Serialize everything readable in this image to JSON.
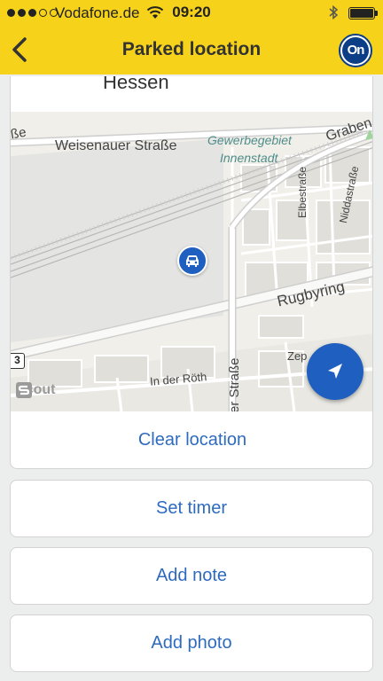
{
  "status_bar": {
    "signal_bars": 5,
    "signal_filled": 3,
    "carrier": "Vodafone.de",
    "time": "09:20",
    "battery_level": 1.0
  },
  "navbar": {
    "title": "Parked location",
    "back_icon": "chevron-left-icon",
    "logo_text": "On",
    "logo_colors": {
      "ring": "#0b3e86",
      "fill": "#0b3e86"
    }
  },
  "location": {
    "address_line": "Hessen"
  },
  "map": {
    "labels": {
      "weisenauer": "Weisenauer Straße",
      "graben": "Graben",
      "gewerbe_1": "Gewerbegebiet",
      "gewerbe_2": "Innenstadt",
      "strasse_left": "ße",
      "elbestrasse": "Elbestraße",
      "niddastrasse": "Niddastraße",
      "rugbyring": "Rugbyring",
      "in_der_roth": "In der Röth",
      "er_strasse": "er Straße",
      "zep": "Zep",
      "shield": "3"
    },
    "attribution": "Scout",
    "pin_icon": "car-icon",
    "locate_icon": "navigation-arrow-icon"
  },
  "actions": {
    "clear_location": "Clear location",
    "set_timer": "Set timer",
    "add_note": "Add note",
    "add_photo": "Add photo"
  },
  "colors": {
    "brand_yellow": "#f6d21a",
    "accent_blue": "#1f5fbf",
    "link_blue": "#2e6bbf",
    "background": "#eceded"
  }
}
